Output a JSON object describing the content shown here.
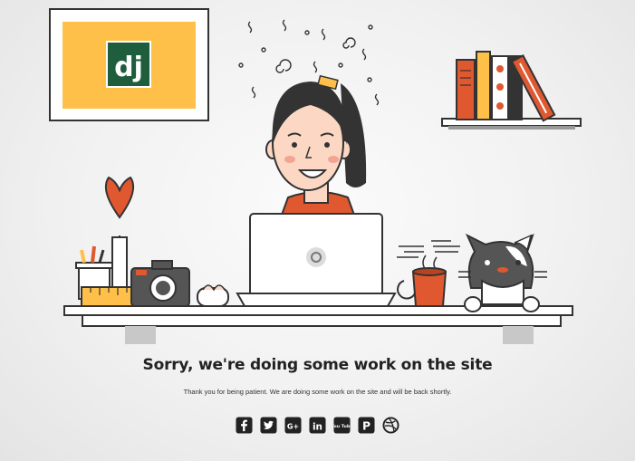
{
  "logo": {
    "text": "dj"
  },
  "message": {
    "headline": "Sorry, we're doing some work on the site",
    "subtext": "Thank you for being patient. We are doing some work on the site and will be back shortly."
  },
  "social": [
    {
      "name": "facebook-icon",
      "glyph": "f"
    },
    {
      "name": "twitter-icon",
      "glyph": ""
    },
    {
      "name": "google-plus-icon",
      "glyph": "G+"
    },
    {
      "name": "linkedin-icon",
      "glyph": "in"
    },
    {
      "name": "youtube-icon",
      "glyph": "You Tube"
    },
    {
      "name": "pinterest-icon",
      "glyph": "P"
    },
    {
      "name": "dribbble-icon",
      "glyph": ""
    }
  ],
  "colors": {
    "accent": "#e0582f",
    "frame_bg": "#ffc04a",
    "logo_green": "#1e5e3c",
    "ink": "#333333"
  }
}
